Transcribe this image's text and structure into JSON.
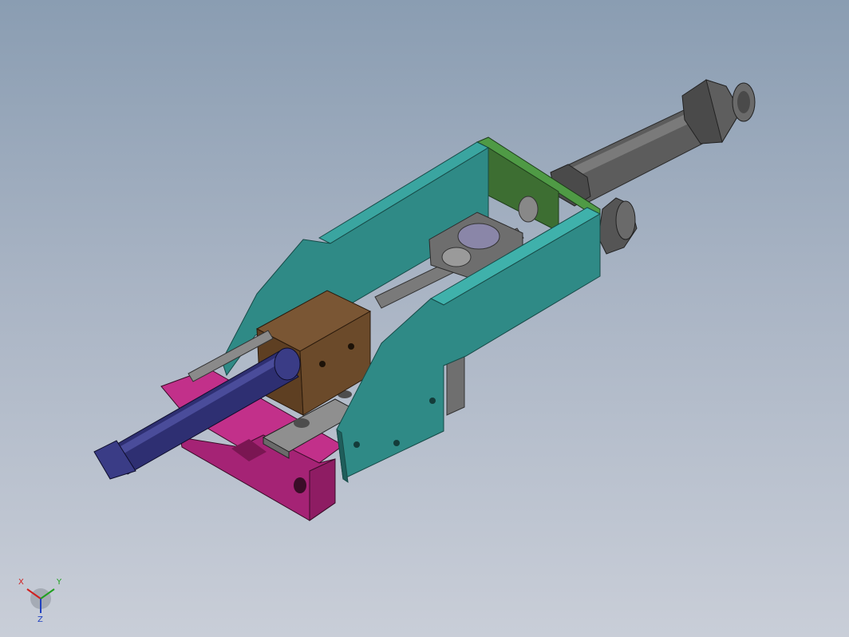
{
  "viewport": {
    "background_top": "#8a9db2",
    "background_bottom": "#c9ced8"
  },
  "model": {
    "parts": [
      {
        "name": "collet-sleeve",
        "color": "#2e2f72"
      },
      {
        "name": "magenta-base-block",
        "color": "#b6287c"
      },
      {
        "name": "gray-guide-rail",
        "color": "#8b8b8b"
      },
      {
        "name": "brown-slider-block",
        "color": "#6a4a2c"
      },
      {
        "name": "teal-side-plate",
        "color": "#2f8a86"
      },
      {
        "name": "green-end-plate",
        "color": "#4a8a3e"
      },
      {
        "name": "cylinder-rod",
        "color": "#5a5a5a"
      },
      {
        "name": "hex-nut",
        "color": "#4d4d4d"
      }
    ]
  },
  "triad": {
    "x_label": "X",
    "y_label": "Y",
    "z_label": "Z",
    "x_color": "#d02020",
    "y_color": "#20a020",
    "z_color": "#2040c0"
  }
}
